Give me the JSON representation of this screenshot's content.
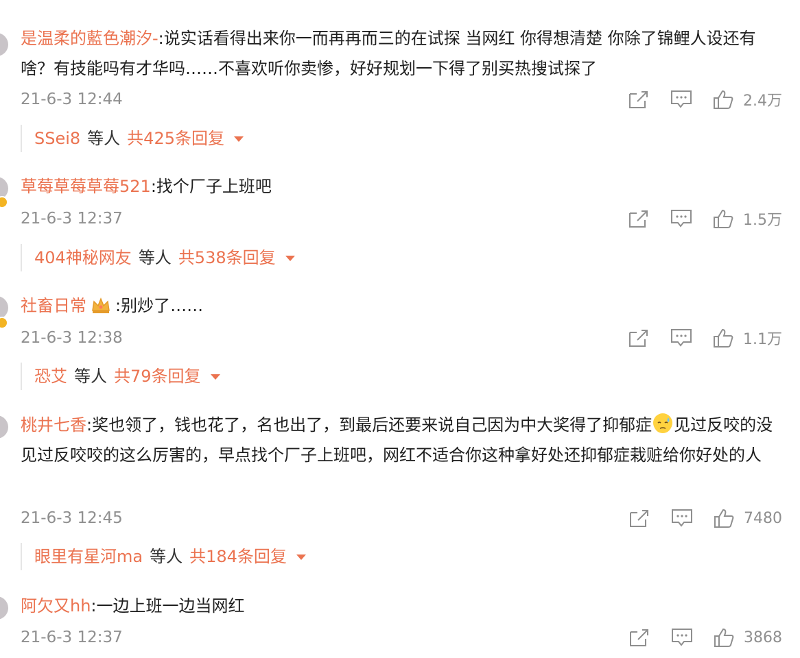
{
  "comments": [
    {
      "user": "是温柔的藍色潮汐-",
      "text": ":说实话看得出来你一而再再而三的在试探  当网红 你得想清楚 你除了锦鲤人设还有啥？有技能吗有才华吗……不喜欢听你卖惨，好好规划一下得了别买热搜试探了",
      "time": "21-6-3 12:44",
      "likes": "2.4万",
      "replies": {
        "name": "SSei8",
        "mid": "等人",
        "total": "共425条回复"
      }
    },
    {
      "user": "草莓草莓草莓521",
      "text": ":找个厂子上班吧",
      "time": "21-6-3 12:37",
      "likes": "1.5万",
      "replies": {
        "name": "404神秘网友",
        "mid": "等人",
        "total": "共538条回复"
      }
    },
    {
      "user": "社畜日常",
      "text": ":别炒了……",
      "time": "21-6-3 12:38",
      "likes": "1.1万",
      "replies": {
        "name": "恐艾",
        "mid": "等人",
        "total": "共79条回复"
      }
    },
    {
      "user": "桃井七香",
      "text_a": ":奖也领了，钱也花了，名也出了，到最后还要来说自己因为中大奖得了抑郁症",
      "text_b": "见过反咬的没见过反咬咬的这么厉害的，早点找个厂子上班吧，网红不适合你这种拿好处还抑郁症栽赃给你好处的人",
      "time": "21-6-3 12:45",
      "likes": "7480",
      "replies": {
        "name": "眼里有星河ma",
        "mid": "等人",
        "total": "共184条回复"
      }
    },
    {
      "user": "阿欠又hh",
      "text": ":一边上班一边当网红",
      "time": "21-6-3 12:37",
      "likes": "3868"
    }
  ],
  "icons": {
    "share": "share-icon",
    "comment": "comment-icon",
    "like": "thumbs-up-icon",
    "emoji": "sweat-face-emoji",
    "crown": "crown-badge"
  },
  "colors": {
    "username": "#eb7350",
    "meta": "#8f8f8f",
    "text": "#1f1f1f"
  }
}
